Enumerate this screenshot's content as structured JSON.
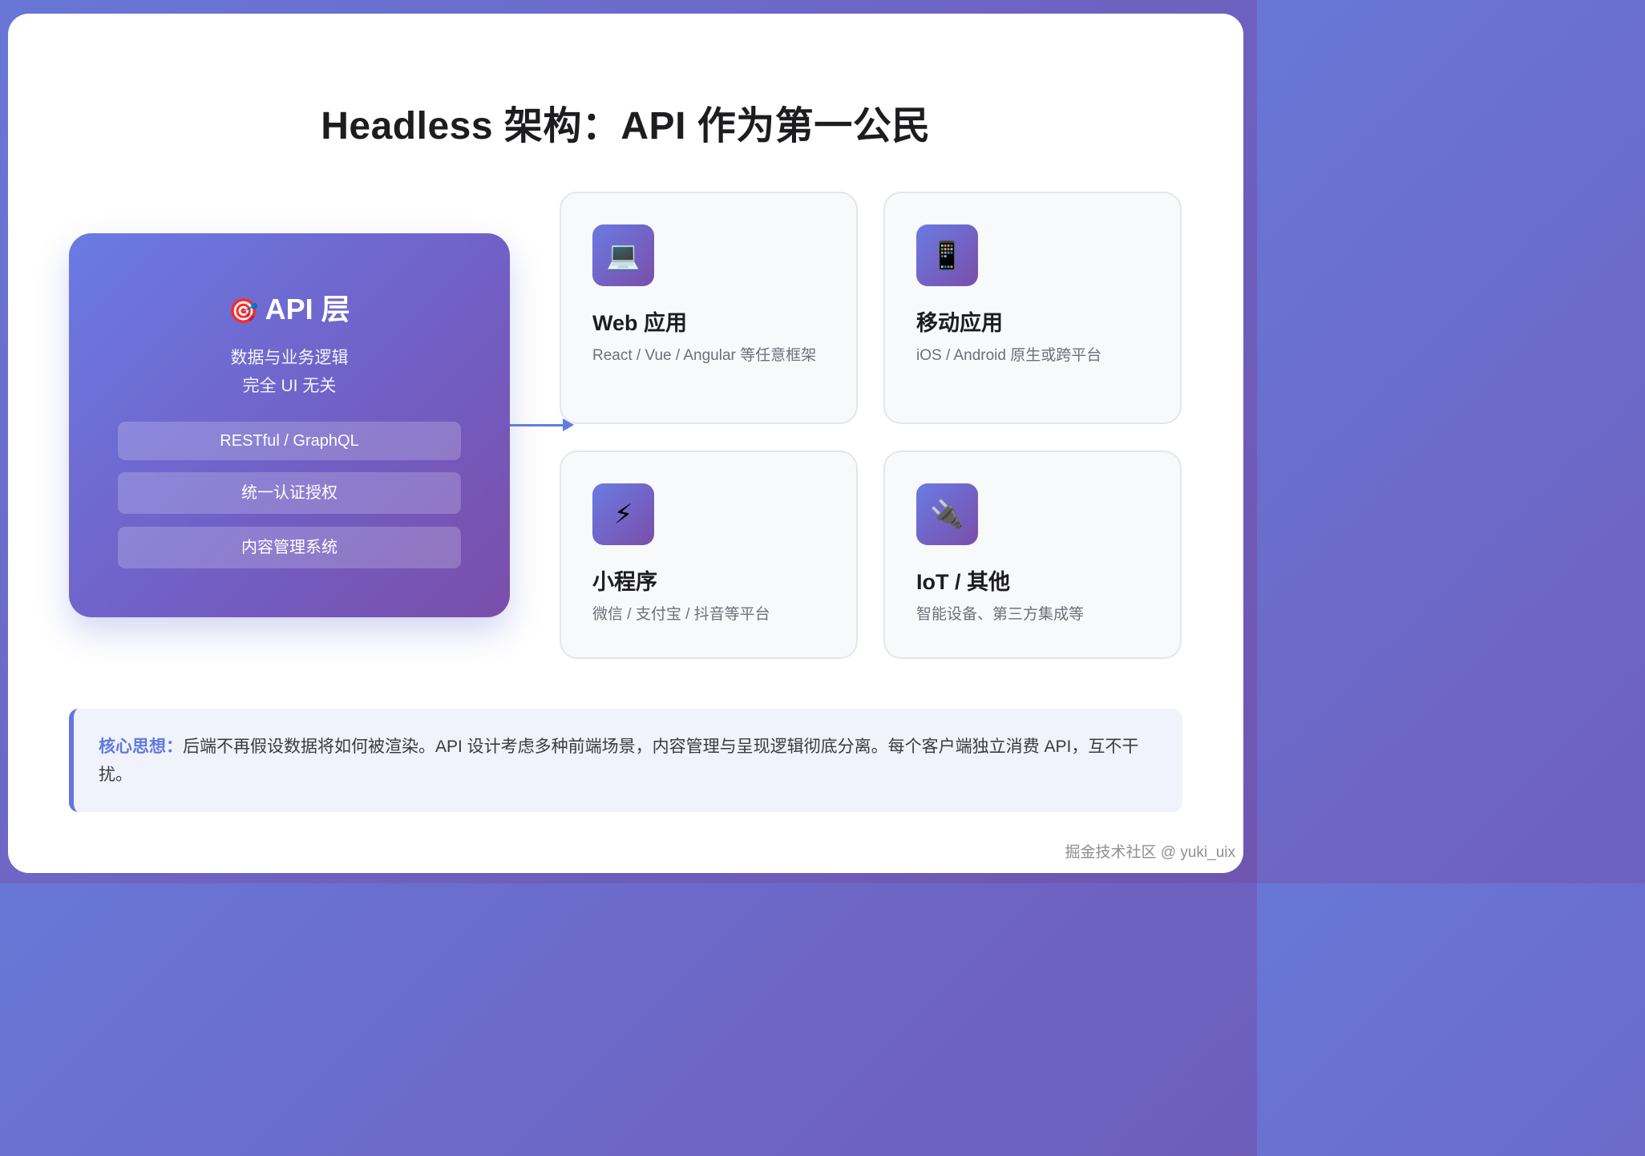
{
  "title": "Headless 架构：API 作为第一公民",
  "api_layer": {
    "icon": "target-icon",
    "icon_glyph": "🎯",
    "title": "API 层",
    "desc_line1": "数据与业务逻辑",
    "desc_line2": "完全 UI 无关",
    "items": [
      "RESTful / GraphQL",
      "统一认证授权",
      "内容管理系统"
    ]
  },
  "clients": [
    {
      "icon": "laptop-icon",
      "icon_glyph": "💻",
      "title": "Web 应用",
      "desc": "React / Vue / Angular 等任意框架"
    },
    {
      "icon": "mobile-phone-icon",
      "icon_glyph": "📱",
      "title": "移动应用",
      "desc": "iOS / Android 原生或跨平台"
    },
    {
      "icon": "lightning-icon",
      "icon_glyph": "⚡",
      "title": "小程序",
      "desc": "微信 / 支付宝 / 抖音等平台"
    },
    {
      "icon": "plug-icon",
      "icon_glyph": "🔌",
      "title": "IoT / 其他",
      "desc": "智能设备、第三方集成等"
    }
  ],
  "note": {
    "label": "核心思想：",
    "text": "后端不再假设数据将如何被渲染。API 设计考虑多种前端场景，内容管理与呈现逻辑彻底分离。每个客户端独立消费 API，互不干扰。"
  },
  "watermark": "掘金技术社区 @ yuki_uix",
  "colors": {
    "accent": "#6277dc",
    "gradient_start": "#6a7be3",
    "gradient_end": "#7a4eaa"
  }
}
